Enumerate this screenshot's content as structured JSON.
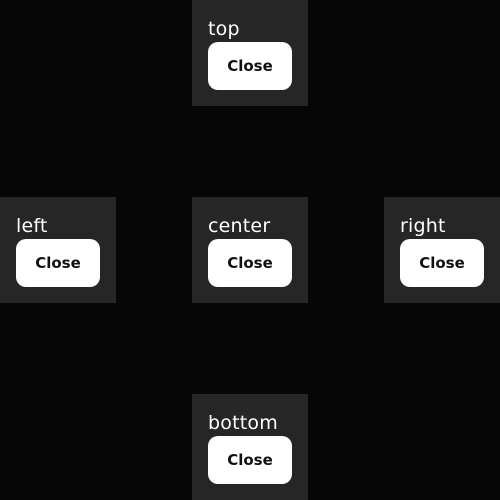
{
  "panels": {
    "top": {
      "label": "top",
      "button_label": "Close"
    },
    "left": {
      "label": "left",
      "button_label": "Close"
    },
    "center": {
      "label": "center",
      "button_label": "Close"
    },
    "right": {
      "label": "right",
      "button_label": "Close"
    },
    "bottom": {
      "label": "bottom",
      "button_label": "Close"
    }
  },
  "colors": {
    "background": "#060606",
    "panel": "#262626",
    "button": "#ffffff",
    "button_text": "#111111",
    "label_text": "#ffffff"
  }
}
